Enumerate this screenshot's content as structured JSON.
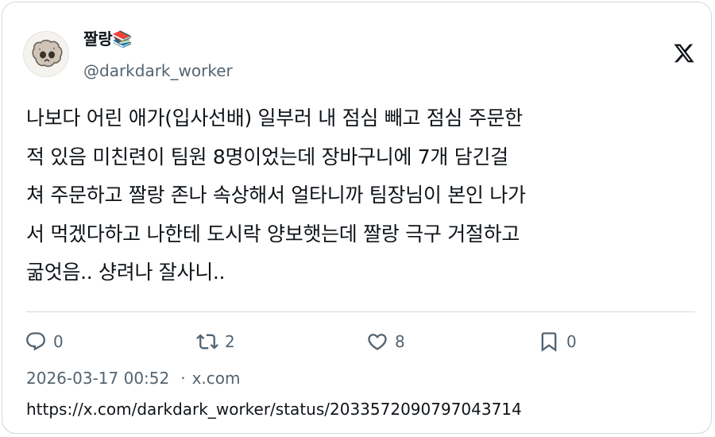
{
  "author": {
    "display_name": "짤랑📚",
    "handle": "@darkdark_worker"
  },
  "icons": {
    "avatar": "skull-character-avatar",
    "platform": "x-logo-icon",
    "reply": "reply-bubble-icon",
    "retweet": "retweet-icon",
    "like": "heart-icon",
    "bookmark": "bookmark-icon"
  },
  "tweet": {
    "lines": [
      "나보다 어린 애가(입사선배) 일부러 내 점심 빼고 점심 주문한",
      "적 있음 미친련이 팀원 8명이었는데 장바구니에 7개 담긴걸",
      "쳐 주문하고 짤랑 존나 속상해서 얼타니까 팀장님이 본인 나가",
      "서 먹겠다하고 나한테 도시락 양보햇는데 짤랑 극구 거절하고",
      "굶엇음.. 샹려나 잘사니.."
    ]
  },
  "stats": {
    "replies": "0",
    "retweets": "2",
    "likes": "8",
    "bookmarks": "0"
  },
  "meta": {
    "timestamp": "2026-03-17 00:52",
    "separator": "·",
    "source": "x.com",
    "url": "https://x.com/darkdark_worker/status/2033572090797043714"
  },
  "colors": {
    "text": "#0f1419",
    "secondary": "#536471",
    "border": "#cfd9de"
  }
}
